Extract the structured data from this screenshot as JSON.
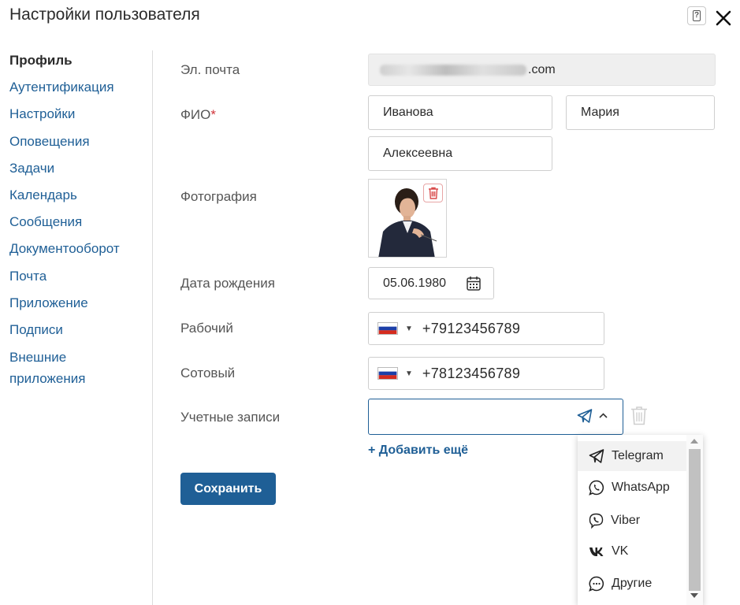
{
  "dialog": {
    "title": "Настройки пользователя",
    "help_icon": "help-icon",
    "close_icon": "close-icon"
  },
  "sidebar": {
    "items": [
      {
        "label": "Профиль",
        "active": true
      },
      {
        "label": "Аутентификация"
      },
      {
        "label": "Настройки"
      },
      {
        "label": "Оповещения"
      },
      {
        "label": "Задачи"
      },
      {
        "label": "Календарь"
      },
      {
        "label": "Сообщения"
      },
      {
        "label": "Документооборот"
      },
      {
        "label": "Почта"
      },
      {
        "label": "Приложение"
      },
      {
        "label": "Подписи"
      },
      {
        "label_line1": "Внешние",
        "label_line2": "приложения"
      }
    ]
  },
  "form": {
    "email_label": "Эл. почта",
    "email_value_suffix": ".com",
    "name_label": "ФИО",
    "required_mark": "*",
    "last_name": "Иванова",
    "first_name": "Мария",
    "middle_name": "Алексеевна",
    "photo_label": "Фотография",
    "birth_label": "Дата рождения",
    "birth_value": "05.06.1980",
    "work_phone_label": "Рабочий",
    "work_phone": "+79123456789",
    "mobile_label": "Сотовый",
    "mobile_phone": "+78123456789",
    "accounts_label": "Учетные записи",
    "add_more": "+ Добавить ещё",
    "save": "Сохранить"
  },
  "dropdown": {
    "options": [
      {
        "label": "Telegram",
        "icon": "telegram-icon",
        "highlighted": true
      },
      {
        "label": "WhatsApp",
        "icon": "whatsapp-icon"
      },
      {
        "label": "Viber",
        "icon": "viber-icon"
      },
      {
        "label": "VK",
        "icon": "vk-icon"
      },
      {
        "label": "Другие",
        "icon": "chat-icon"
      }
    ]
  },
  "colors": {
    "accent": "#1f5f96",
    "required": "#d0343a",
    "danger": "#d94a4a"
  }
}
